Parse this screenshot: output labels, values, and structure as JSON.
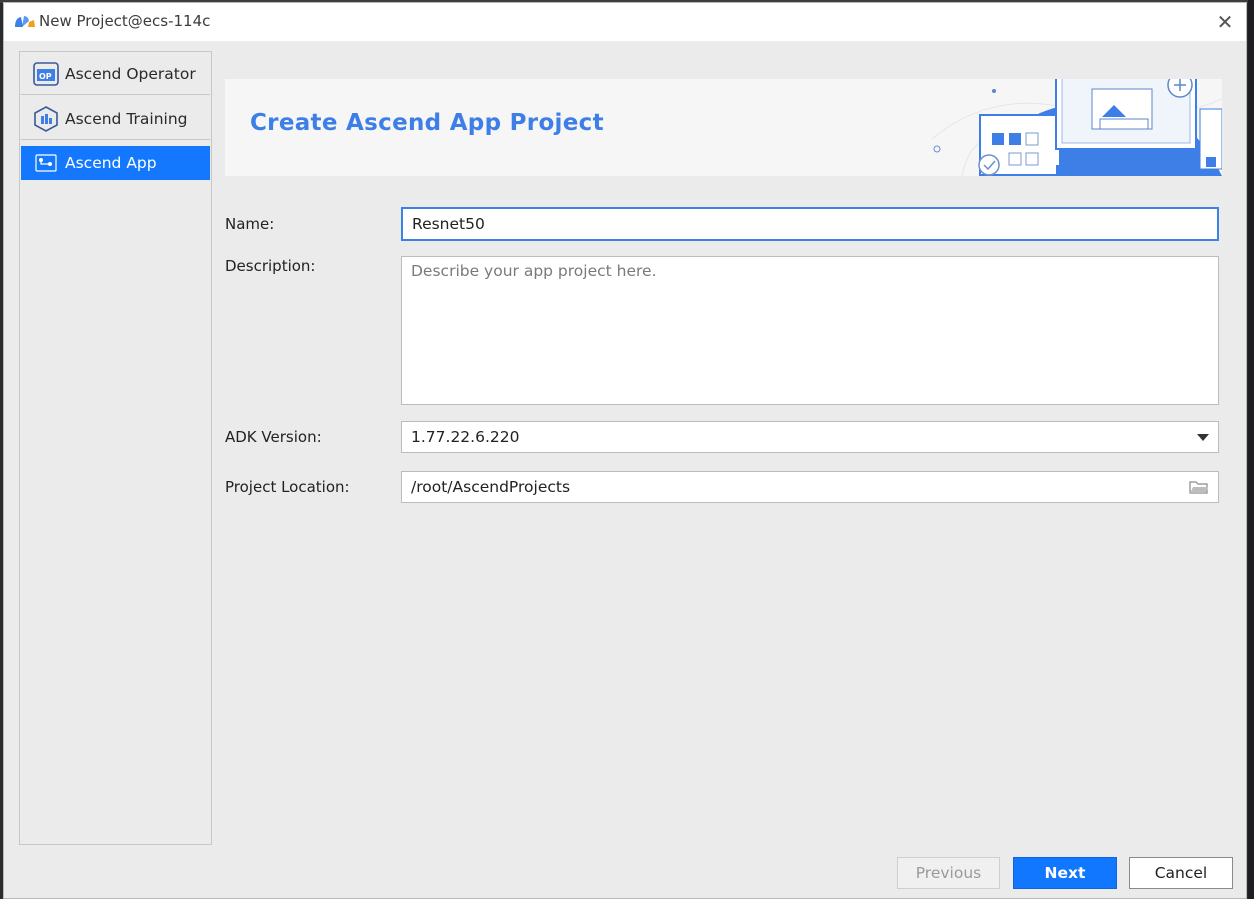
{
  "window": {
    "title": "New Project@ecs-114c"
  },
  "sidebar": {
    "items": [
      {
        "label": "Ascend Operator",
        "icon": "ascend-operator-icon",
        "active": false
      },
      {
        "label": "Ascend Training",
        "icon": "ascend-training-icon",
        "active": false
      },
      {
        "label": "Ascend App",
        "icon": "ascend-app-icon",
        "active": true
      }
    ]
  },
  "banner": {
    "title": "Create Ascend App Project"
  },
  "form": {
    "name": {
      "label": "Name:",
      "value": "Resnet50"
    },
    "description": {
      "label": "Description:",
      "placeholder": "Describe your app project here."
    },
    "adk_version": {
      "label": "ADK Version:",
      "value": "1.77.22.6.220"
    },
    "project_location": {
      "label": "Project Location:",
      "value": "/root/AscendProjects"
    }
  },
  "buttons": {
    "previous": "Previous",
    "next": "Next",
    "cancel": "Cancel"
  },
  "colors": {
    "accent": "#1478ff",
    "banner_title": "#3d7fe6",
    "next_button": "#1177ff"
  }
}
